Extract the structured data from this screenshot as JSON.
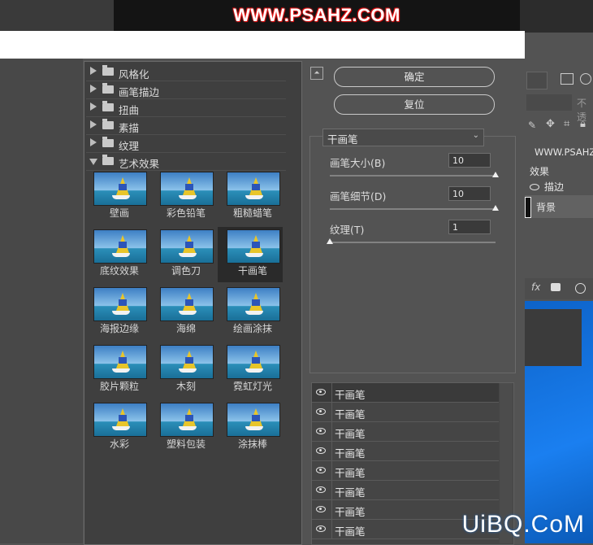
{
  "banner": {
    "text": "WWW.PSAHZ.COM"
  },
  "ps_right": {
    "site_text": "WWW.PSAHZ.COM",
    "effects_label": "效果",
    "stroke_label": "描边",
    "background_layer": "背景",
    "opacity_label": "不透"
  },
  "categories": [
    {
      "label": "风格化",
      "open": false
    },
    {
      "label": "画笔描边",
      "open": false
    },
    {
      "label": "扭曲",
      "open": false
    },
    {
      "label": "素描",
      "open": false
    },
    {
      "label": "纹理",
      "open": false
    },
    {
      "label": "艺术效果",
      "open": true
    }
  ],
  "thumbnails": [
    {
      "label": "壁画"
    },
    {
      "label": "彩色铅笔"
    },
    {
      "label": "粗糙蜡笔"
    },
    {
      "label": "底纹效果"
    },
    {
      "label": "调色刀"
    },
    {
      "label": "干画笔",
      "selected": true
    },
    {
      "label": "海报边缘"
    },
    {
      "label": "海绵"
    },
    {
      "label": "绘画涂抹"
    },
    {
      "label": "胶片颗粒"
    },
    {
      "label": "木刻"
    },
    {
      "label": "霓虹灯光"
    },
    {
      "label": "水彩"
    },
    {
      "label": "塑料包装"
    },
    {
      "label": "涂抹棒"
    }
  ],
  "buttons": {
    "ok": "确定",
    "reset": "复位"
  },
  "filter_select": {
    "value": "干画笔"
  },
  "params": [
    {
      "label": "画笔大小(B)",
      "value": "10",
      "level": 1.0
    },
    {
      "label": "画笔细节(D)",
      "value": "10",
      "level": 1.0
    },
    {
      "label": "纹理(T)",
      "value": "1",
      "level": 0.0
    }
  ],
  "effect_layers": [
    {
      "label": "干画笔",
      "active": true
    },
    {
      "label": "干画笔"
    },
    {
      "label": "干画笔"
    },
    {
      "label": "干画笔"
    },
    {
      "label": "干画笔"
    },
    {
      "label": "干画笔"
    },
    {
      "label": "干画笔"
    },
    {
      "label": "干画笔"
    }
  ],
  "watermark": "UiBQ.CoM",
  "colors": {
    "dialog_bg": "#535353",
    "list_bg": "#3f3f3f",
    "selected": "#2a2a2a",
    "desktop": "#1a7ff0"
  }
}
